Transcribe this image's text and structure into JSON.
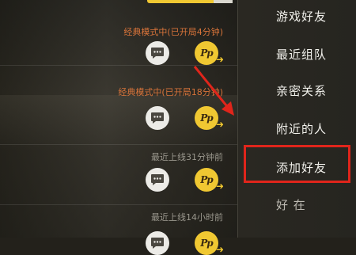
{
  "friend_list": {
    "rows": [
      {
        "status": "经典模式中(已开局4分钟)",
        "status_color": "#d9743a"
      },
      {
        "status": "经典模式中(已开局18分钟)",
        "status_color": "#d9743a"
      },
      {
        "status": "最近上线31分钟前",
        "status_color": "#9a978d"
      },
      {
        "status": "最近上线14小时前",
        "status_color": "#9a978d"
      }
    ]
  },
  "menu": {
    "items": [
      {
        "label": "游戏好友"
      },
      {
        "label": "最近组队"
      },
      {
        "label": "亲密关系"
      },
      {
        "label": "附近的人"
      },
      {
        "label": "添加好友"
      },
      {
        "label": "好 在"
      }
    ],
    "highlighted": "添加好友"
  },
  "icons": {
    "chat": "chat-bubble-icon",
    "pubg": "pubg-logo-icon"
  },
  "colors": {
    "annotation_red": "#e0251b",
    "accent_yellow": "#f0c832"
  }
}
